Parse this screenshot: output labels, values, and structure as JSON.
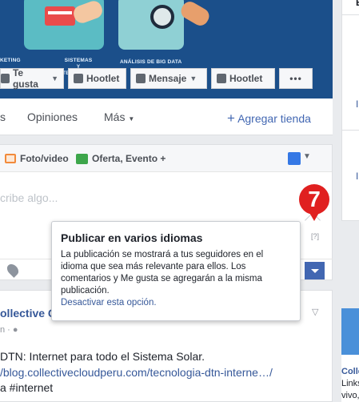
{
  "cover": {
    "captions": [
      "KETING",
      "SISTEMAS Y TECNOLOGÍA DE",
      "ANÁLISIS DE BIG DATA"
    ]
  },
  "actions": {
    "like": "Te gusta",
    "hootlet_1": "Hootlet",
    "message": "Mensaje",
    "hootlet_2": "Hootlet",
    "more": "•••"
  },
  "tabs": {
    "prev": "s",
    "reviews": "Opiniones",
    "more": "Más",
    "add_store": "Agregar tienda"
  },
  "composer": {
    "photo_video": "Foto/video",
    "offer_event": "Oferta, Evento +",
    "placeholder": "cribe algo...",
    "help": "[?]"
  },
  "annotation": {
    "number": "7"
  },
  "tooltip": {
    "title": "Publicar en varios idiomas",
    "body": "La publicación se mostrará a tus seguidores en el idioma que sea más relevante para ellos. Los comentarios y Me gusta se agregarán a la misma publicación.",
    "link": "Desactivar esta opción."
  },
  "post": {
    "author": "ollective Cl",
    "meta": "n · ",
    "line_1": "DTN: Internet para todo el Sistema Solar.",
    "line_2": "/blog.collectivecloudperu.com/tecnologia-dtn-interne…/",
    "line_3": "a #internet"
  },
  "right_column": {
    "top_text": "E",
    "item_1": "Ir",
    "item_2": "Ir",
    "ad_title": "Colle",
    "ad_line_1": "Links",
    "ad_line_2": "vivo,"
  },
  "colors": {
    "facebook_blue": "#4267b2",
    "cover_blue": "#1b4f8a",
    "badge_red": "#e02020"
  }
}
